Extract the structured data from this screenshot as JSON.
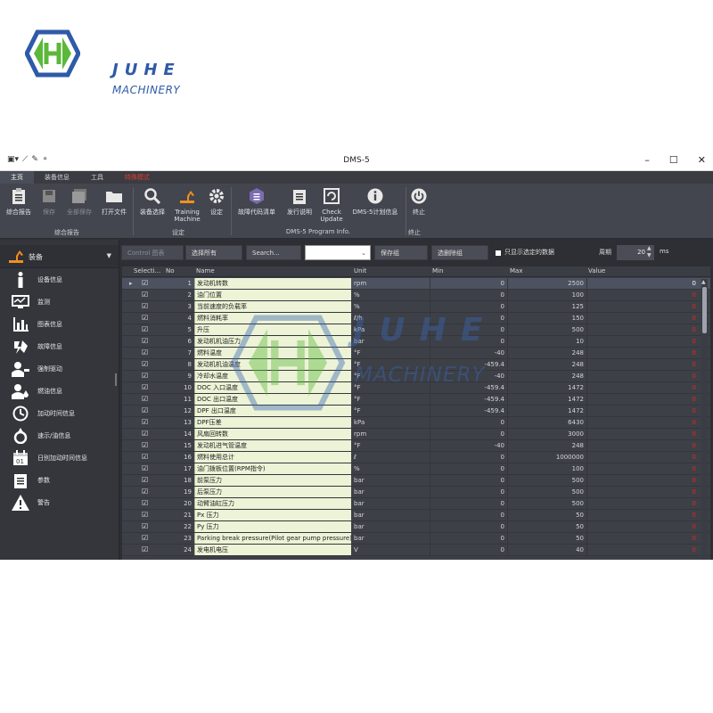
{
  "logo": {
    "line1": "JUHE",
    "line2": "MACHINERY"
  },
  "window": {
    "title": "DMS-5",
    "minimize": "–",
    "maximize": "☐",
    "close": "✕"
  },
  "menu": {
    "tabs": [
      "主页",
      "装备信息",
      "工具",
      "特殊模式"
    ]
  },
  "ribbon": {
    "buttons": {
      "report": "综合报告",
      "save": "保存",
      "save_all": "全部保存",
      "open_file": "打开文件",
      "equip_select": "装备选择",
      "training1": "Training",
      "training2": "Machine",
      "settings": "设定",
      "fault_list": "故障代码清单",
      "release_notes": "发行说明",
      "check1": "Check",
      "check2": "Update",
      "dms_info": "DMS-5计划信息",
      "exit": "终止"
    },
    "groups": {
      "report": "综合报告",
      "settings": "设定",
      "program": "DMS-5 Program Info.",
      "exit": "终止"
    }
  },
  "left_nav": {
    "header": "装备",
    "items": [
      "设备信息",
      "监测",
      "图表信息",
      "故障信息",
      "强制驱动",
      "燃油信息",
      "加动时间信息",
      "速示/油信息",
      "日别加动时间信息",
      "参数",
      "警告"
    ]
  },
  "toolbar": {
    "control_chart": "Control 图表",
    "select_all": "选择所有",
    "search_placeholder": "Search...",
    "save_group": "保存组",
    "delete_group": "选删除组",
    "only_selected": "只显示选定的数据",
    "period_label": "周期",
    "period_value": "20",
    "period_unit": "ms"
  },
  "table": {
    "columns": [
      "Selecti...",
      "No",
      "Name",
      "Unit",
      "Min",
      "Max",
      "Value"
    ],
    "rows": [
      {
        "no": "1",
        "name": "发动机转数",
        "unit": "rpm",
        "min": "0",
        "max": "2500",
        "value": "0"
      },
      {
        "no": "2",
        "name": "油门位置",
        "unit": "%",
        "min": "0",
        "max": "100",
        "value": "0"
      },
      {
        "no": "3",
        "name": "当前速度的负载率",
        "unit": "%",
        "min": "0",
        "max": "125",
        "value": "0"
      },
      {
        "no": "4",
        "name": "燃料消耗率",
        "unit": "ℓ/h",
        "min": "0",
        "max": "150",
        "value": "0"
      },
      {
        "no": "5",
        "name": "升压",
        "unit": "kPa",
        "min": "0",
        "max": "500",
        "value": "0"
      },
      {
        "no": "6",
        "name": "发动机机油压力",
        "unit": "bar",
        "min": "0",
        "max": "10",
        "value": "0"
      },
      {
        "no": "7",
        "name": "燃料温度",
        "unit": "°F",
        "min": "-40",
        "max": "248",
        "value": "0"
      },
      {
        "no": "8",
        "name": "发动机机油温度",
        "unit": "°F",
        "min": "-459.4",
        "max": "248",
        "value": "0"
      },
      {
        "no": "9",
        "name": "冷却水温度",
        "unit": "°F",
        "min": "-40",
        "max": "248",
        "value": "0"
      },
      {
        "no": "10",
        "name": "DOC 入口温度",
        "unit": "°F",
        "min": "-459.4",
        "max": "1472",
        "value": "0"
      },
      {
        "no": "11",
        "name": "DOC 出口温度",
        "unit": "°F",
        "min": "-459.4",
        "max": "1472",
        "value": "0"
      },
      {
        "no": "12",
        "name": "DPF 出口温度",
        "unit": "°F",
        "min": "-459.4",
        "max": "1472",
        "value": "0"
      },
      {
        "no": "13",
        "name": "DPF压差",
        "unit": "kPa",
        "min": "0",
        "max": "6430",
        "value": "0"
      },
      {
        "no": "14",
        "name": "风扇回转数",
        "unit": "rpm",
        "min": "0",
        "max": "3000",
        "value": "0"
      },
      {
        "no": "15",
        "name": "发动机进气管温度",
        "unit": "°F",
        "min": "-40",
        "max": "248",
        "value": "0"
      },
      {
        "no": "16",
        "name": "燃料使用总计",
        "unit": "ℓ",
        "min": "0",
        "max": "1000000",
        "value": "0"
      },
      {
        "no": "17",
        "name": "油门拨板位置(RPM指令)",
        "unit": "%",
        "min": "0",
        "max": "100",
        "value": "0"
      },
      {
        "no": "18",
        "name": "前泵压力",
        "unit": "bar",
        "min": "0",
        "max": "500",
        "value": "0"
      },
      {
        "no": "19",
        "name": "后泵压力",
        "unit": "bar",
        "min": "0",
        "max": "500",
        "value": "0"
      },
      {
        "no": "20",
        "name": "动臂油缸压力",
        "unit": "bar",
        "min": "0",
        "max": "500",
        "value": "0"
      },
      {
        "no": "21",
        "name": "Px 压力",
        "unit": "bar",
        "min": "0",
        "max": "50",
        "value": "0"
      },
      {
        "no": "22",
        "name": "Py 压力",
        "unit": "bar",
        "min": "0",
        "max": "50",
        "value": "0"
      },
      {
        "no": "23",
        "name": "Parking break pressure(Pilot gear pump pressure)",
        "unit": "bar",
        "min": "0",
        "max": "50",
        "value": "0"
      },
      {
        "no": "24",
        "name": "发电机电压",
        "unit": "V",
        "min": "0",
        "max": "40",
        "value": "0"
      }
    ]
  },
  "colors": {
    "accent_red": "#e0281e",
    "name_cell_bg": "#ecf3d6",
    "logo_blue": "#2f5aa8",
    "logo_green": "#5bb83a"
  }
}
